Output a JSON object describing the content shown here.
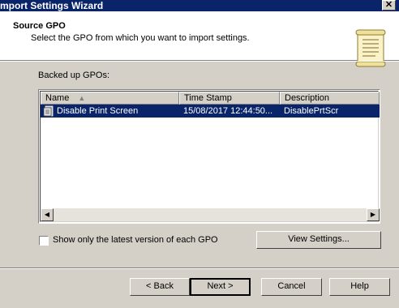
{
  "window": {
    "title": "mport Settings Wizard",
    "close_glyph": "✕"
  },
  "header": {
    "title": "Source GPO",
    "subtitle": "Select the GPO from which you want to import settings.",
    "icon": "scroll-icon"
  },
  "list": {
    "label": "Backed up GPOs:",
    "columns": [
      "Name",
      "Time Stamp",
      "Description"
    ],
    "sort_indicator": "▲",
    "rows": [
      {
        "name": "Disable Print Screen",
        "timestamp": "15/08/2017 12:44:50...",
        "description": "DisablePrtScr",
        "selected": true
      }
    ]
  },
  "options": {
    "latest_only_label": "Show only the latest version of each GPO",
    "latest_only_checked": false
  },
  "buttons": {
    "view_settings": "View Settings...",
    "back": "< Back",
    "next": "Next >",
    "cancel": "Cancel",
    "help": "Help"
  },
  "colors": {
    "title_bar": "#0a246a",
    "selection": "#0a246a",
    "dialog_bg": "#d4d0c8"
  }
}
